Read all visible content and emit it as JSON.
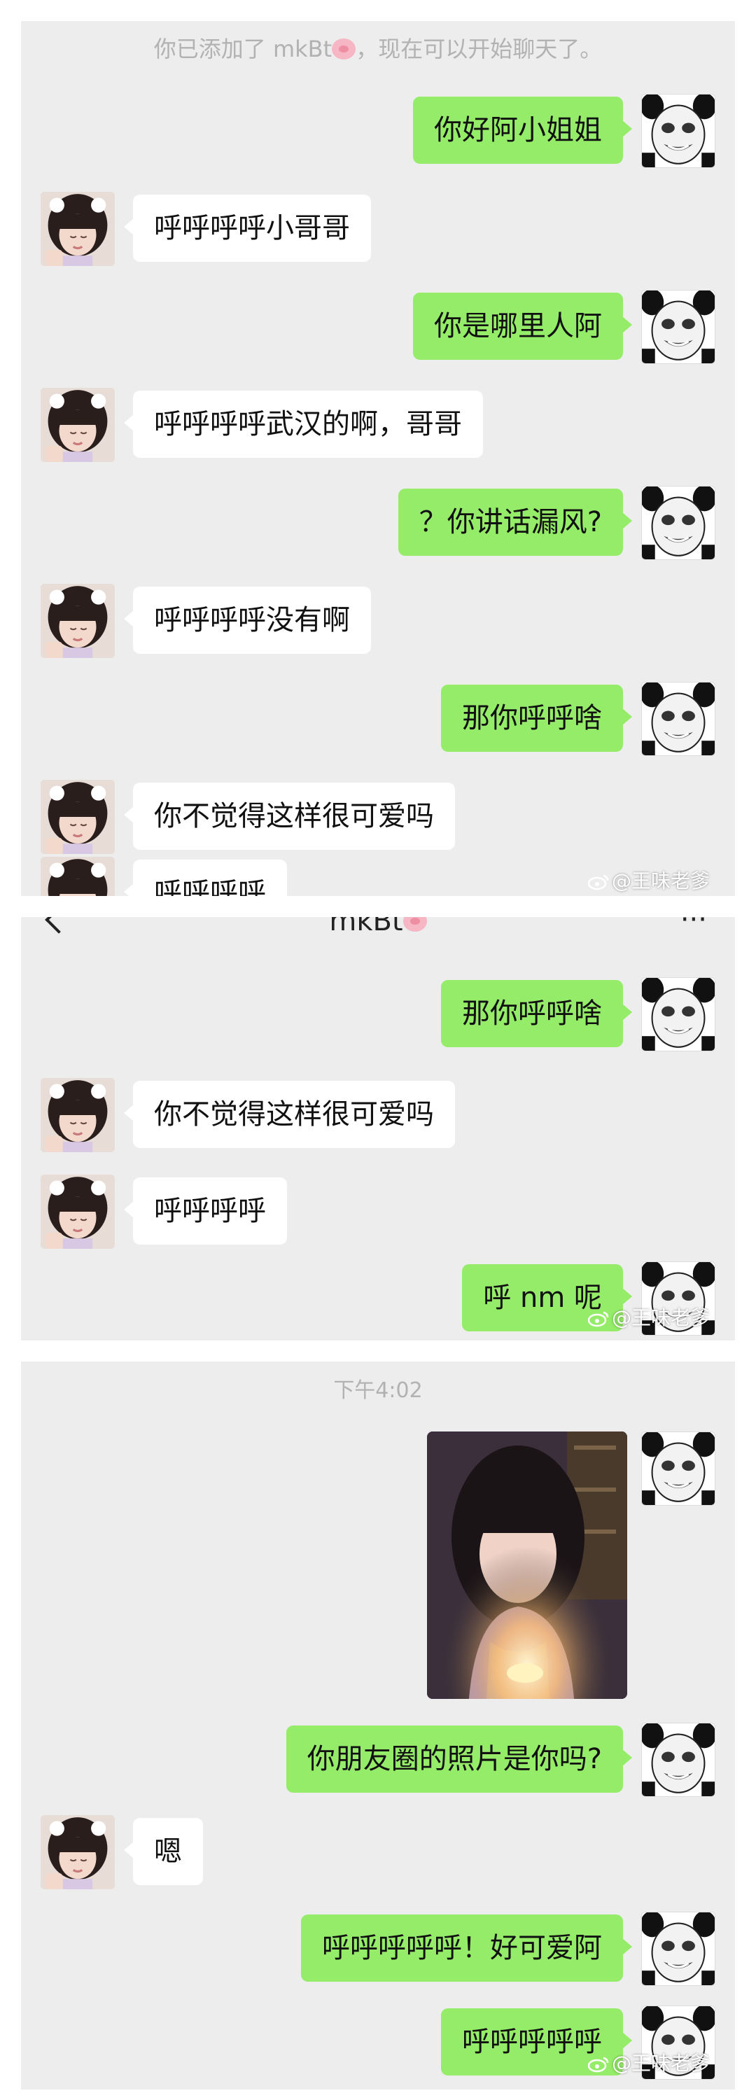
{
  "panel1": {
    "system_notice": "你已添加了 mkBt",
    "system_notice_tail": "，现在可以开始聊天了。",
    "messages": [
      {
        "from": "me",
        "text": "你好阿小姐姐"
      },
      {
        "from": "them",
        "text": "呼呼呼呼小哥哥"
      },
      {
        "from": "me",
        "text": "你是哪里人阿"
      },
      {
        "from": "them",
        "text": "呼呼呼呼武汉的啊，哥哥"
      },
      {
        "from": "me",
        "text": "？你讲话漏风?"
      },
      {
        "from": "them",
        "text": "呼呼呼呼没有啊"
      },
      {
        "from": "me",
        "text": "那你呼呼啥"
      },
      {
        "from": "them",
        "text": "你不觉得这样很可爱吗"
      },
      {
        "from": "them",
        "text": "呼呼呼呼"
      }
    ],
    "watermark": "@王味老爹"
  },
  "panel2": {
    "chat_title": "mkBt",
    "messages": [
      {
        "from": "me",
        "text": "那你呼呼啥"
      },
      {
        "from": "them",
        "text": "你不觉得这样很可爱吗"
      },
      {
        "from": "them",
        "text": "呼呼呼呼"
      },
      {
        "from": "me",
        "text": "呼 nm 呢"
      }
    ],
    "watermark": "@王味老爹"
  },
  "panel3": {
    "timestamp": "下午4:02",
    "messages": [
      {
        "from": "me",
        "text": "你朋友圈的照片是你吗?"
      },
      {
        "from": "them",
        "text": "嗯"
      },
      {
        "from": "me",
        "text": "呼呼呼呼呼！好可爱阿"
      },
      {
        "from": "me",
        "text": "呼呼呼呼呼"
      }
    ],
    "watermark": "@王味老爹"
  },
  "colors": {
    "my_bubble": "#95ec69",
    "their_bubble": "#ffffff",
    "chat_background": "#ededed",
    "system_text": "#b2b2b2"
  },
  "icons": [
    "panda-meme-avatar-icon",
    "girl-avatar-icon",
    "pig-emoji-icon",
    "weibo-icon",
    "back-chevron-icon",
    "more-dots-icon"
  ]
}
